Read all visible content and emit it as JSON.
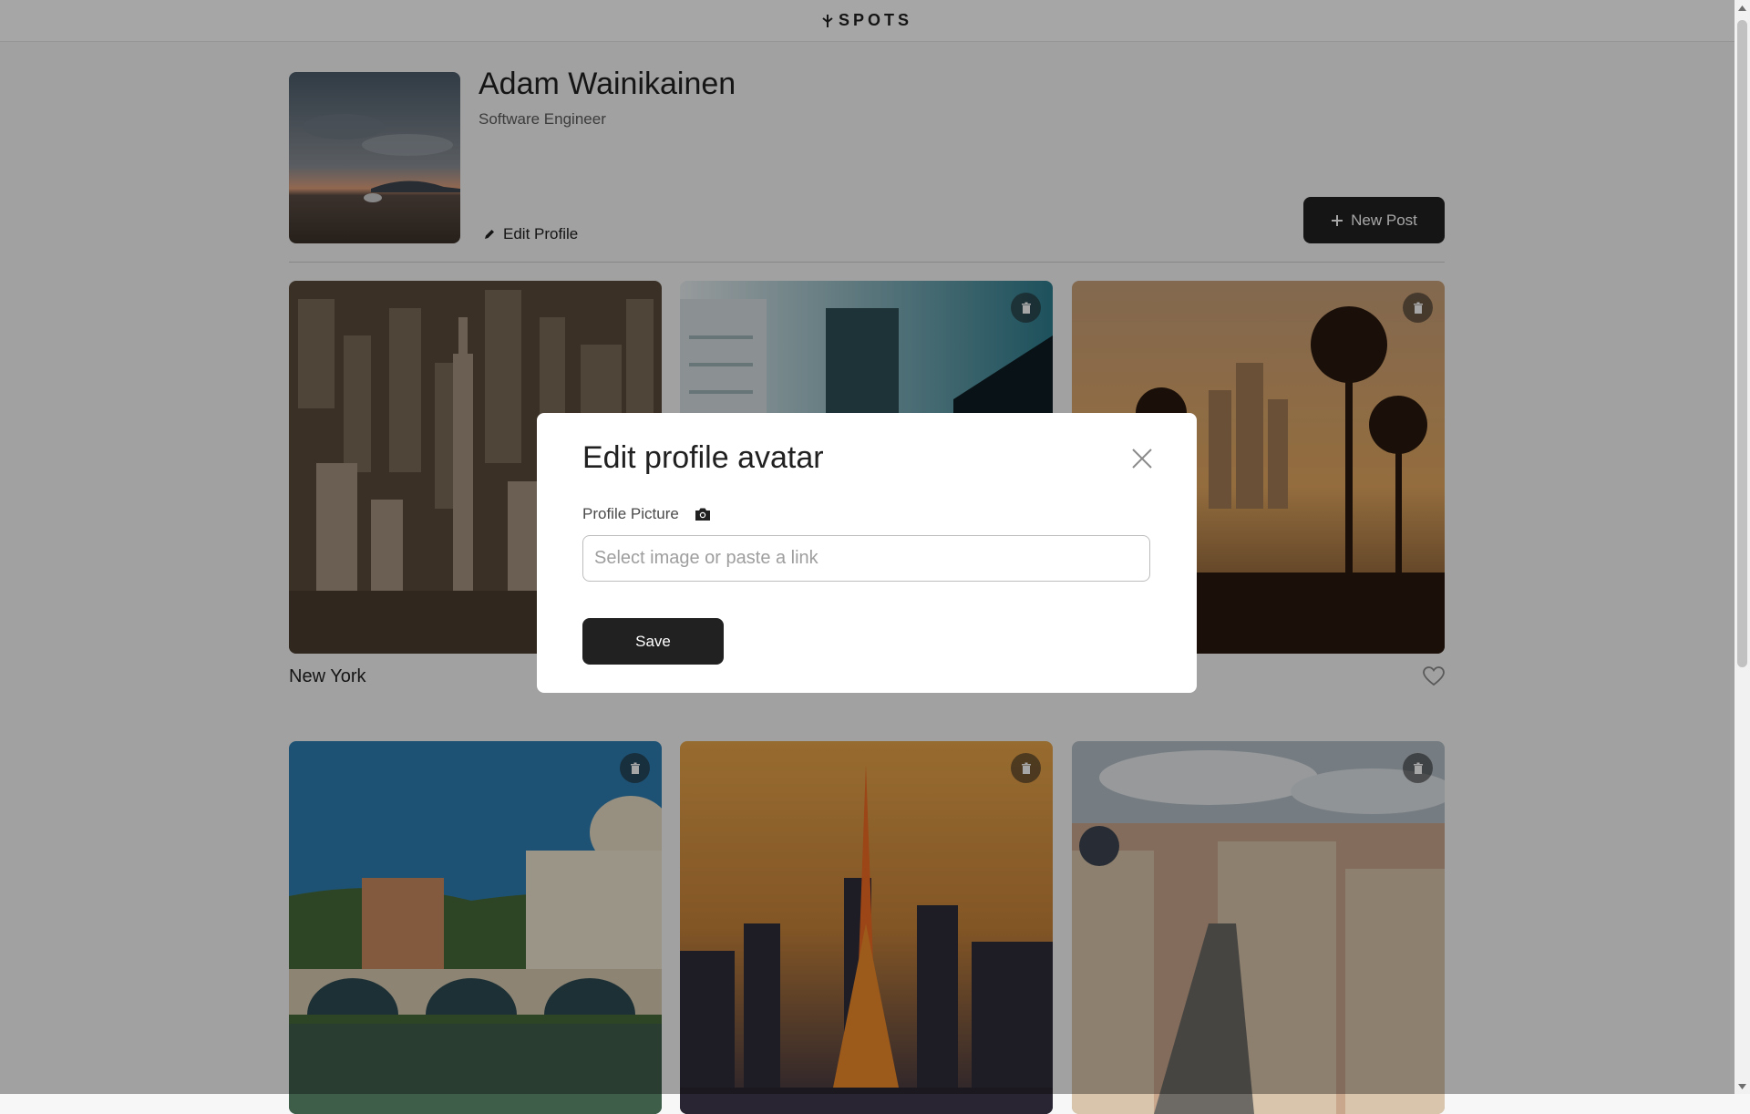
{
  "header": {
    "logo_text": "SPOTS"
  },
  "profile": {
    "name": "Adam Wainikainen",
    "job": "Software Engineer",
    "edit_label": "Edit Profile",
    "new_post_label": "New Post"
  },
  "cards": [
    {
      "title": "New York"
    },
    {
      "title": ""
    },
    {
      "title": ""
    },
    {
      "title": ""
    },
    {
      "title": ""
    },
    {
      "title": ""
    }
  ],
  "modal": {
    "title": "Edit profile avatar",
    "field_label": "Profile Picture",
    "input_placeholder": "Select image or paste a link",
    "input_value": "",
    "save_label": "Save"
  },
  "colors": {
    "primary": "#212121",
    "background": "#f7f7f7",
    "overlay": "rgba(0,0,0,0.35)"
  },
  "icons": {
    "logo": "spots-logo-icon",
    "edit": "pencil-icon",
    "new_post": "plus-icon",
    "delete": "trash-icon",
    "like": "heart-icon",
    "close": "close-icon",
    "field": "camera-icon"
  }
}
